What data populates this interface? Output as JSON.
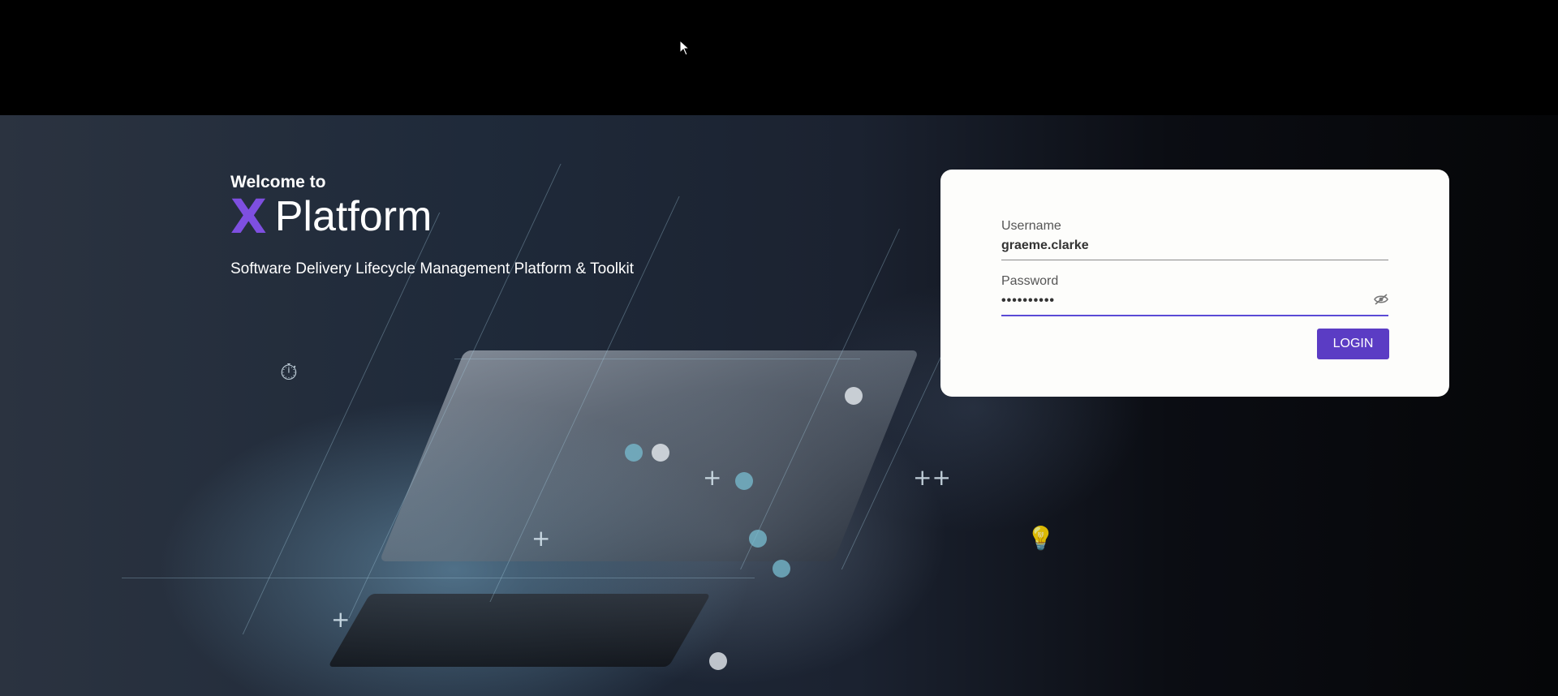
{
  "hero": {
    "welcome": "Welcome to",
    "logo_letter": "X",
    "platform_name": "Platform",
    "tagline": "Software Delivery Lifecycle Management Platform & Toolkit"
  },
  "login": {
    "username_label": "Username",
    "username_value": "graeme.clarke",
    "password_label": "Password",
    "password_value": "••••••••••",
    "login_button": "LOGIN",
    "password_toggle_icon": "eye-off-icon"
  },
  "colors": {
    "accent": "#5b3cc4",
    "logo": "#7e4fe0",
    "card_bg": "#fdfdfb"
  }
}
